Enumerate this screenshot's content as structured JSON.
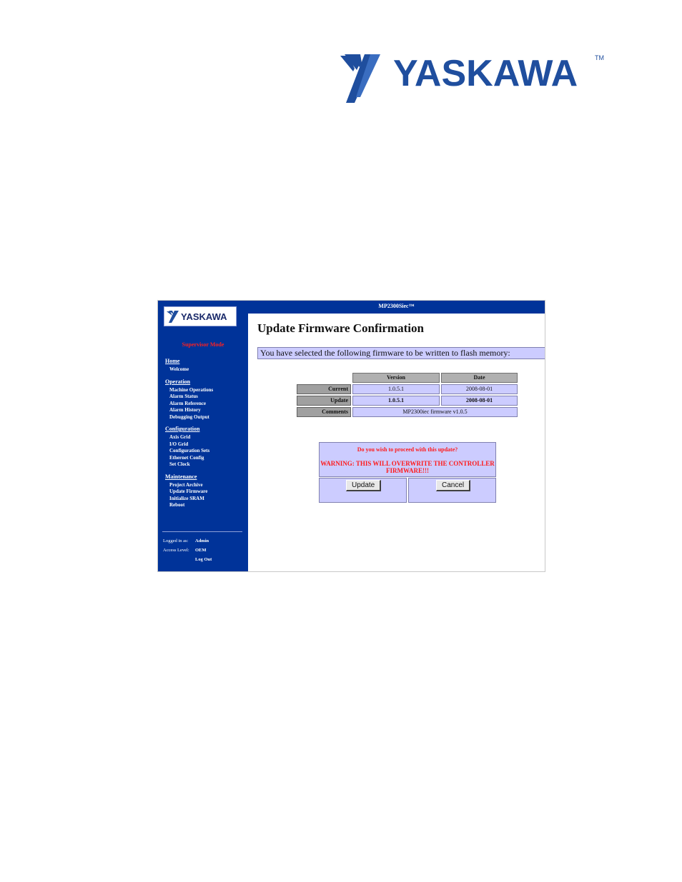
{
  "page_header": {
    "logo_text": "YASKAWA",
    "logo_mark": "TM",
    "brand_color": "#1f4e9e"
  },
  "app": {
    "title": "MP2300Siec™",
    "mode": "Supervisor Mode",
    "sidebar_color": "#003399",
    "side_logo_text": "YASKAWA"
  },
  "sidebar": {
    "sections": [
      {
        "label": "Home",
        "items": [
          "Welcome"
        ]
      },
      {
        "label": "Operation",
        "items": [
          "Machine Operations",
          "Alarm Status",
          "Alarm Reference",
          "Alarm History",
          "Debugging Output"
        ]
      },
      {
        "label": "Configuration",
        "items": [
          "Axis Grid",
          "I/O Grid",
          "Configuration Sets",
          "Ethernet Config",
          "Set Clock"
        ]
      },
      {
        "label": "Maintenance",
        "items": [
          "Project Archive",
          "Update Firmware",
          "Initialize SRAM",
          "Reboot"
        ]
      }
    ],
    "login": {
      "logged_in_label": "Logged in as:",
      "logged_in_value": "Admin",
      "access_label": "Access Level:",
      "access_value": "OEM",
      "logout": "Log Out"
    }
  },
  "main": {
    "title": "Update Firmware Confirmation",
    "info": "You have selected the following firmware to be written to flash memory:",
    "table": {
      "headers": [
        "Version",
        "Date"
      ],
      "rows": [
        {
          "label": "Current",
          "version": "1.0.5.1",
          "date": "2008-08-01"
        },
        {
          "label": "Update",
          "version": "1.0.5.1",
          "date": "2008-08-01"
        }
      ],
      "comments_label": "Comments",
      "comments_value": "MP2300iec firmware v1.0.5"
    },
    "confirm": {
      "question": "Do you wish to proceed with this update?",
      "warning": "WARNING: THIS WILL OVERWRITE THE CONTROLLER FIRMWARE!!!",
      "update_label": "Update",
      "cancel_label": "Cancel",
      "warning_color": "#ff1a1a"
    }
  }
}
